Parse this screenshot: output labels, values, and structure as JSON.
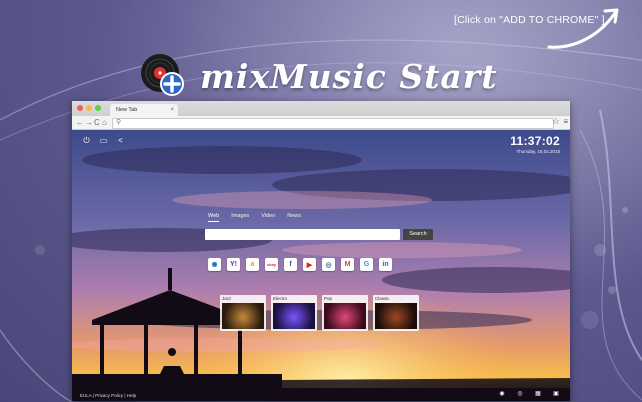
{
  "promo": {
    "hint_text": "[Click on \"ADD TO CHROME\" ]",
    "brand_name": "mixMusic Start",
    "disc_icon": "music-disc-plus-icon"
  },
  "browser": {
    "tab_title": "New Tab",
    "tab_close": "×",
    "nav_back": "←",
    "nav_forward": "→",
    "nav_reload": "C",
    "nav_home": "⌂",
    "bookmark_star": "☆",
    "menu": "≡"
  },
  "newtab": {
    "clock_time": "11:37:02",
    "clock_date": "Thursday, 16.02.2018",
    "top_icons": [
      "power-icon",
      "screen-icon",
      "share-icon"
    ],
    "search_tabs": [
      "Web",
      "Images",
      "Video",
      "News"
    ],
    "active_search_tab": "Web",
    "search_value": "",
    "search_button": "Search",
    "shortcuts": [
      {
        "name": "musicbrainz",
        "glyph": "✺",
        "color": "#2b72c8"
      },
      {
        "name": "yahoo",
        "glyph": "Y!",
        "color": "#5a2fb6"
      },
      {
        "name": "amazon",
        "glyph": "a",
        "color": "#f39c12"
      },
      {
        "name": "ebay",
        "glyph": "ebay",
        "color": "#e53238"
      },
      {
        "name": "facebook",
        "glyph": "f",
        "color": "#3b5998"
      },
      {
        "name": "youtube",
        "glyph": "▶",
        "color": "#e62117"
      },
      {
        "name": "instagram",
        "glyph": "◎",
        "color": "#3f729b"
      },
      {
        "name": "gmail",
        "glyph": "M",
        "color": "#d44638"
      },
      {
        "name": "google",
        "glyph": "G",
        "color": "#4285f4"
      },
      {
        "name": "linkedin",
        "glyph": "in",
        "color": "#0077b5"
      }
    ],
    "genres": [
      {
        "label": "Jazz",
        "colors": [
          "#2a1a0e",
          "#c68a3a"
        ]
      },
      {
        "label": "Electro",
        "colors": [
          "#1a1040",
          "#7b55ff"
        ]
      },
      {
        "label": "Pop",
        "colors": [
          "#3a0b1a",
          "#e0487a"
        ]
      },
      {
        "label": "Classic",
        "colors": [
          "#1c0d08",
          "#9a4a22"
        ]
      }
    ],
    "footer": "EULA | Privacy Policy | Help",
    "footer_icons": [
      "camera-icon",
      "eye-icon",
      "grid-icon",
      "image-icon"
    ]
  }
}
